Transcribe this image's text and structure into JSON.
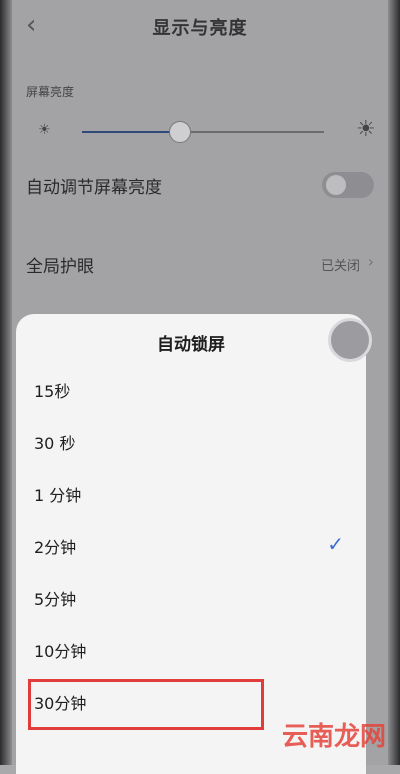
{
  "header": {
    "title": "显示与亮度",
    "back_icon": "chevron-left-icon"
  },
  "brightness": {
    "section_label": "屏幕亮度",
    "level_fraction": 0.4,
    "small_sun_icon": "sun-small-icon",
    "large_sun_icon": "sun-large-icon"
  },
  "settings": {
    "auto_brightness_label": "自动调节屏幕亮度",
    "auto_brightness_on": false,
    "eye_protection_label": "全局护眼",
    "eye_protection_value": "已关闭"
  },
  "dialog": {
    "title": "自动锁屏",
    "options": [
      {
        "label": "15秒"
      },
      {
        "label": "30 秒"
      },
      {
        "label": "1 分钟"
      },
      {
        "label": "2分钟",
        "selected": true
      },
      {
        "label": "5分钟"
      },
      {
        "label": "10分钟"
      },
      {
        "label": "30分钟"
      }
    ],
    "check_icon": "checkmark-icon"
  },
  "watermark": "云南龙网",
  "colors": {
    "highlight": "#e23b3b",
    "check": "#3d6fd2",
    "watermark": "#e4453a"
  }
}
